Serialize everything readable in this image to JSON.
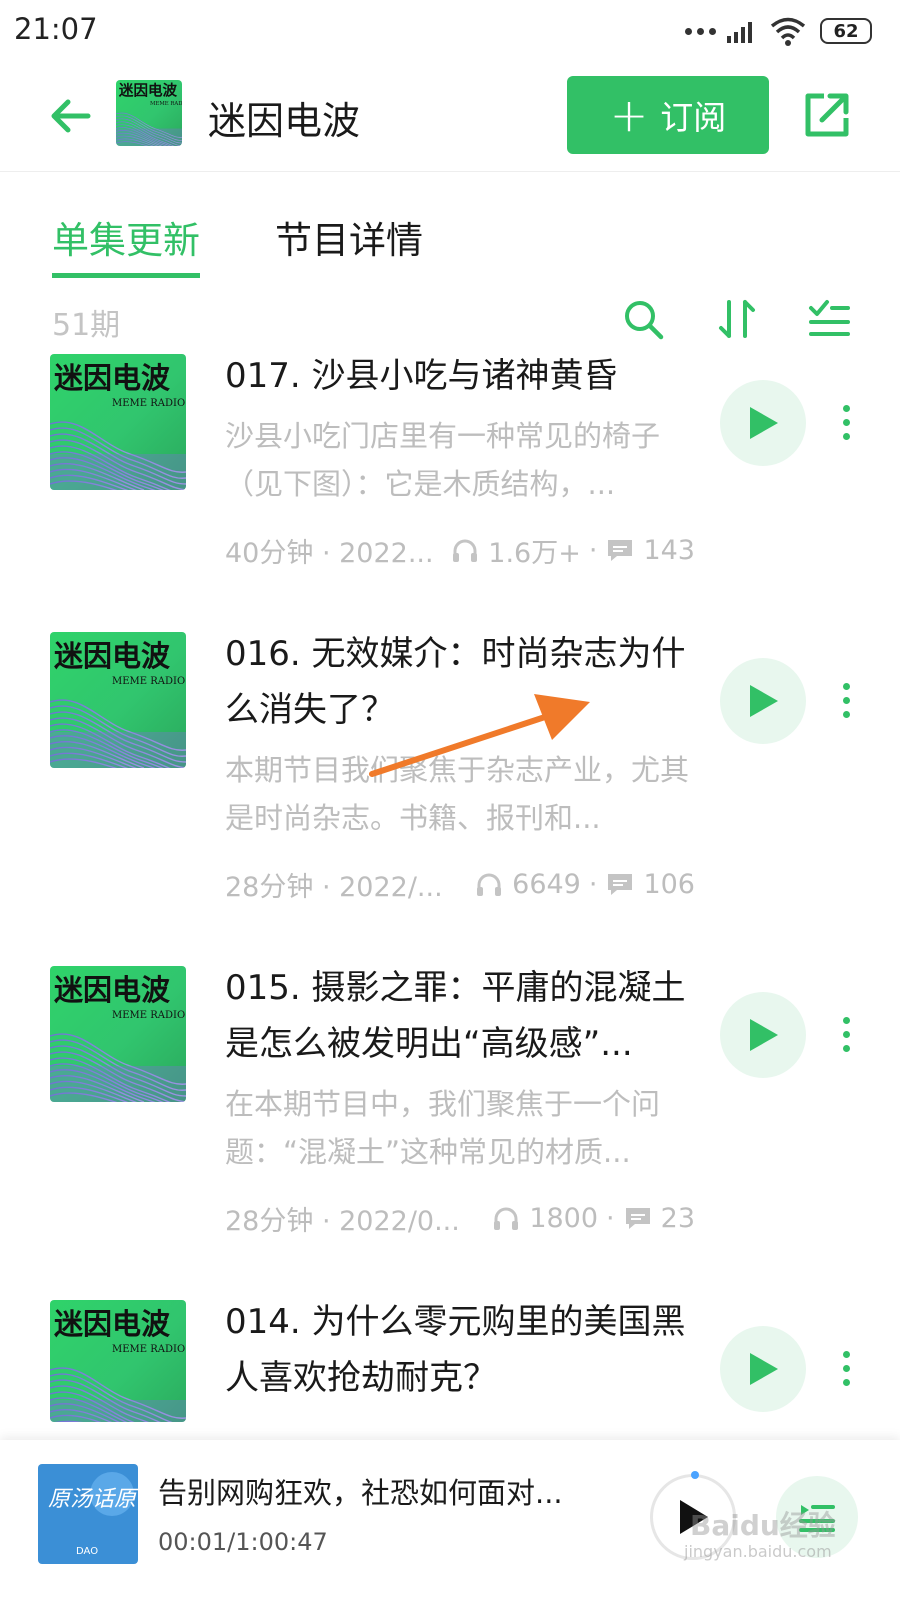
{
  "status_bar": {
    "time": "21:07",
    "battery": "62"
  },
  "header": {
    "title": "迷因电波",
    "subscribe_label": "订阅",
    "cover_title": "迷因电波",
    "cover_subtitle": "MEME RADIO"
  },
  "tabs": [
    {
      "label": "单集更新",
      "active": true
    },
    {
      "label": "节目详情",
      "active": false
    }
  ],
  "toolbar": {
    "episode_count": "51期",
    "icons": [
      "search-icon",
      "sort-icon",
      "filter-list-icon"
    ]
  },
  "episodes": [
    {
      "title": "017. 沙县小吃与诸神黄昏",
      "desc": "沙县小吃门店里有一种常见的椅子（见下图）：它是木质结构，...",
      "duration": "40分钟 · 2022...",
      "plays": "1.6万+",
      "comments": "143"
    },
    {
      "title": "016. 无效媒介：时尚杂志为什么消失了？",
      "desc": "本期节目我们聚焦于杂志产业，尤其是时尚杂志。书籍、报刊和...",
      "duration": "28分钟 · 2022/...",
      "plays": "6649",
      "comments": "106"
    },
    {
      "title": "015. 摄影之罪：平庸的混凝土是怎么被发明出“高级感”...",
      "desc": "在本期节目中，我们聚焦于一个问题：“混凝土”这种常见的材质...",
      "duration": "28分钟 · 2022/0...",
      "plays": "1800",
      "comments": "23"
    },
    {
      "title": "014. 为什么零元购里的美国黑人喜欢抢劫耐克？",
      "desc": "",
      "duration": "",
      "plays": "",
      "comments": ""
    }
  ],
  "player": {
    "title": "告别网购狂欢，社恐如何面对...",
    "time": "00:01/1:00:47",
    "cover_text": "原汤话原食",
    "cover_brand": "DAO"
  },
  "watermark": {
    "brand": "Baidu经验",
    "url": "jingyan.baidu.com"
  },
  "colors": {
    "accent": "#32c066",
    "accent_light": "#e8f7ee",
    "muted_text": "#bdbdbd",
    "annotation_arrow": "#f07a2a"
  }
}
